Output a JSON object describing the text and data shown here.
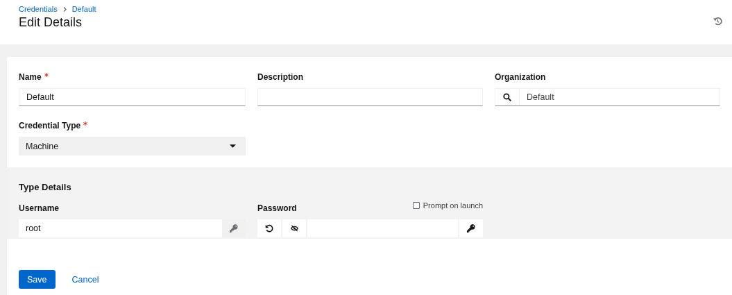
{
  "breadcrumbs": [
    {
      "label": "Credentials"
    },
    {
      "label": "Default"
    }
  ],
  "title": "Edit Details",
  "fields": [
    {
      "label": "Name",
      "required": true,
      "kind": "text",
      "value": "Default"
    },
    {
      "label": "Description",
      "required": false,
      "kind": "text"
    },
    {
      "label": "Organization",
      "required": false,
      "kind": "lookup",
      "value": "Default"
    }
  ],
  "credential_type": {
    "label": "Credential Type",
    "required": true,
    "value": "Machine"
  },
  "type_details": {
    "title": "Type Details",
    "username": {
      "label": "Username",
      "value": "root"
    },
    "password": {
      "label": "Password",
      "prompt_on_launch": {
        "label": "Prompt on launch",
        "checked": false
      }
    }
  },
  "buttons": [
    {
      "label": "Save",
      "kind": "primary"
    },
    {
      "label": "Cancel",
      "kind": "link"
    }
  ]
}
